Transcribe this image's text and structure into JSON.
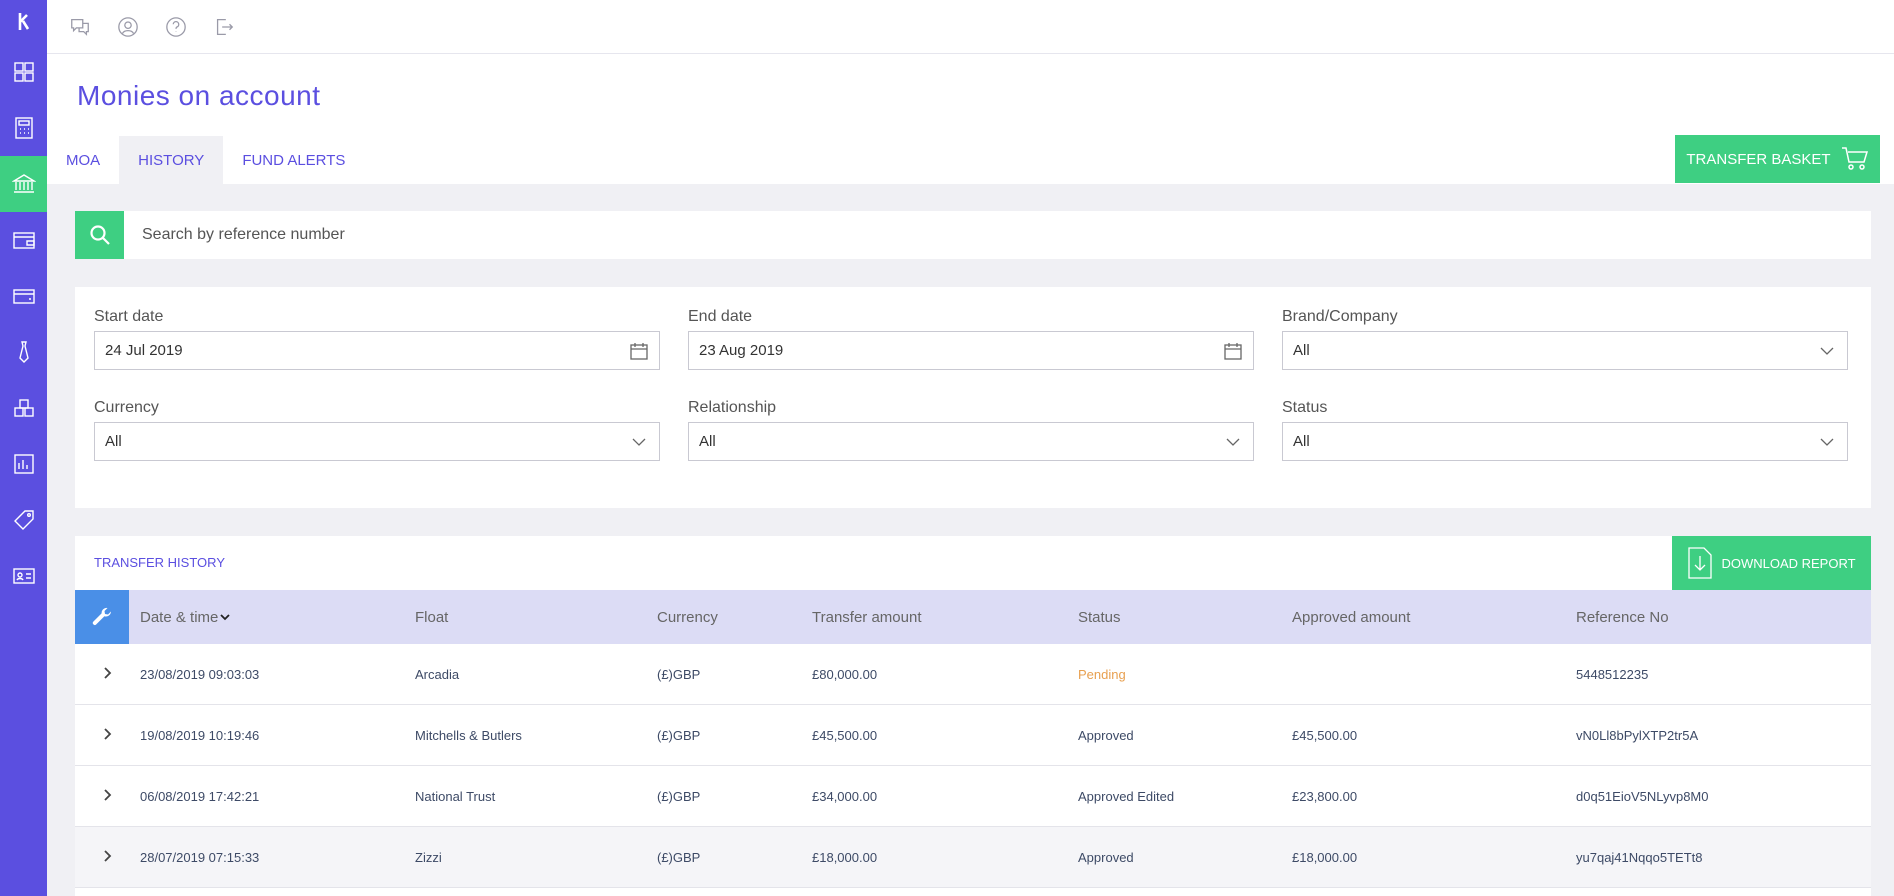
{
  "sidebar": {
    "items": [
      {
        "name": "dashboard-icon"
      },
      {
        "name": "calculator-icon"
      },
      {
        "name": "bank-icon",
        "active": true
      },
      {
        "name": "wallet-icon"
      },
      {
        "name": "card-icon"
      },
      {
        "name": "tie-icon"
      },
      {
        "name": "boxes-icon"
      },
      {
        "name": "chart-icon"
      },
      {
        "name": "tag-icon"
      },
      {
        "name": "id-card-icon"
      }
    ]
  },
  "topbar": {
    "icons": [
      "chat-icon",
      "user-icon",
      "help-icon",
      "logout-icon"
    ]
  },
  "page": {
    "title": "Monies on account"
  },
  "tabs": [
    {
      "label": "MOA",
      "active": false
    },
    {
      "label": "HISTORY",
      "active": true
    },
    {
      "label": "FUND ALERTS",
      "active": false
    }
  ],
  "transfer_basket": {
    "label": "TRANSFER BASKET"
  },
  "search": {
    "placeholder": "Search by reference number"
  },
  "filters": {
    "start_date": {
      "label": "Start date",
      "value": "24 Jul 2019"
    },
    "end_date": {
      "label": "End date",
      "value": "23 Aug 2019"
    },
    "brand": {
      "label": "Brand/Company",
      "value": "All"
    },
    "currency": {
      "label": "Currency",
      "value": "All"
    },
    "relationship": {
      "label": "Relationship",
      "value": "All"
    },
    "status": {
      "label": "Status",
      "value": "All"
    }
  },
  "history": {
    "title": "TRANSFER HISTORY",
    "download_label": "DOWNLOAD REPORT",
    "columns": [
      "Date & time",
      "Float",
      "Currency",
      "Transfer amount",
      "Status",
      "Approved amount",
      "Reference No"
    ],
    "rows": [
      {
        "datetime": "23/08/2019 09:03:03",
        "float": "Arcadia",
        "currency": "(£)GBP",
        "transfer": "£80,000.00",
        "status": "Pending",
        "approved": "",
        "ref": "5448512235"
      },
      {
        "datetime": "19/08/2019 10:19:46",
        "float": "Mitchells & Butlers",
        "currency": "(£)GBP",
        "transfer": "£45,500.00",
        "status": "Approved",
        "approved": "£45,500.00",
        "ref": "vN0Ll8bPylXTP2tr5A"
      },
      {
        "datetime": "06/08/2019 17:42:21",
        "float": "National Trust",
        "currency": "(£)GBP",
        "transfer": "£34,000.00",
        "status": "Approved Edited",
        "approved": "£23,800.00",
        "ref": "d0q51EioV5NLyvp8M0"
      },
      {
        "datetime": "28/07/2019 07:15:33",
        "float": "Zizzi",
        "currency": "(£)GBP",
        "transfer": "£18,000.00",
        "status": "Approved",
        "approved": "£18,000.00",
        "ref": "yu7qaj41Nqqo5TETt8"
      }
    ]
  },
  "colors": {
    "accent": "#5b4fe0",
    "green": "#3ecf82",
    "pending": "#e8a050",
    "header_bg": "#dcdcf5",
    "wrench": "#4a8fe7"
  }
}
